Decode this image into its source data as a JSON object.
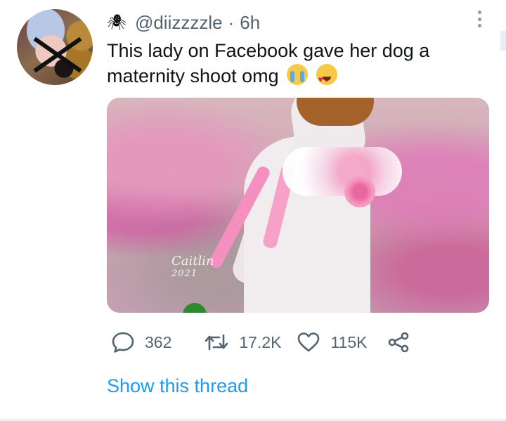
{
  "tweet": {
    "author": {
      "handle": "@diizzzzle",
      "separator": "·",
      "time_ago": "6h"
    },
    "text": "This lady on Facebook gave her dog a maternity shoot omg",
    "emojis": [
      "loudly-crying-face",
      "smiling-face-with-heart-eyes"
    ],
    "media": {
      "watermark_signature": "Caitlin",
      "watermark_year": "2021"
    },
    "stats": {
      "replies": "362",
      "retweets": "17.2K",
      "likes": "115K"
    },
    "show_thread_label": "Show this thread"
  },
  "colors": {
    "link_blue": "#1d9bf0",
    "muted_gray": "#536471",
    "text_black": "#0f1419"
  },
  "icons": {
    "handle_prefix": "spider-icon",
    "menu": "more-vertical-icon",
    "reply": "reply-bubble-icon",
    "retweet": "retweet-icon",
    "like": "heart-icon",
    "share": "share-icon"
  }
}
